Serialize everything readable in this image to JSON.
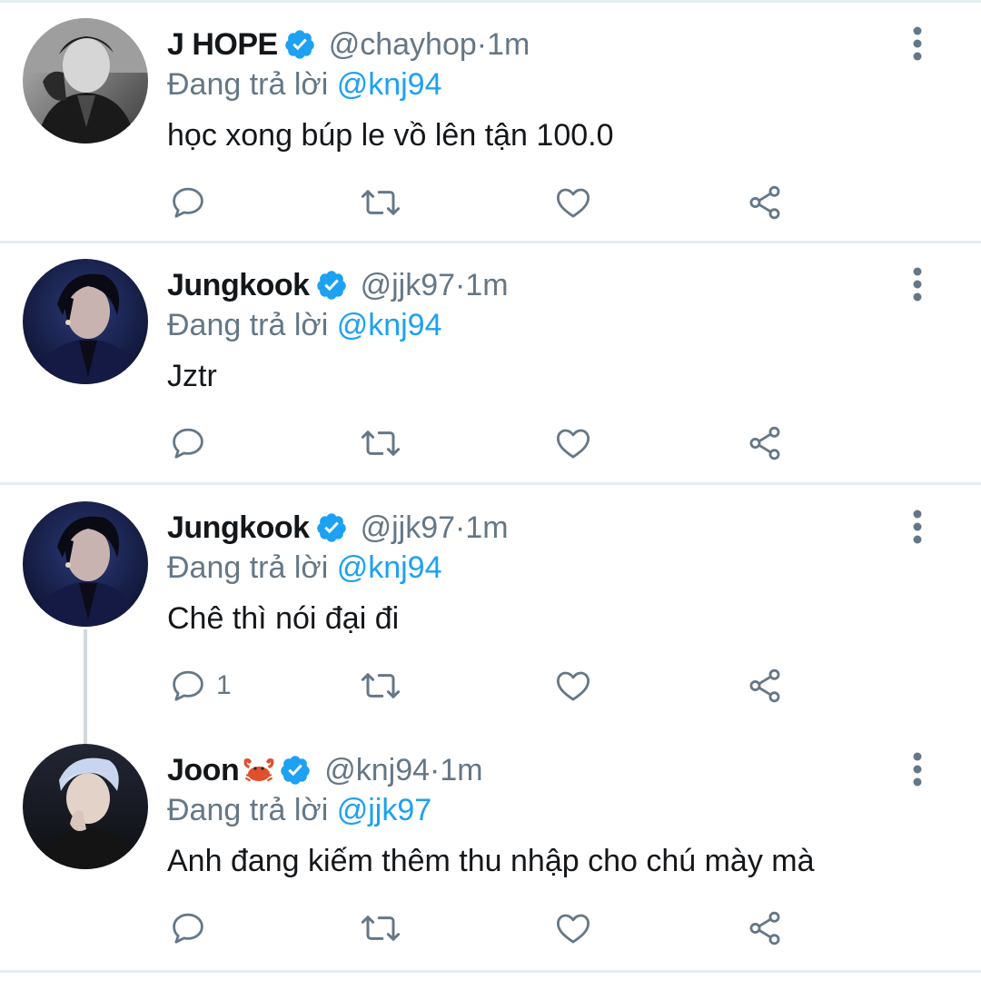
{
  "tweets": [
    {
      "name": "J HOPE",
      "handle": "@chayhop",
      "sep": " · ",
      "time": "1m",
      "reply_prefix": "Đang trả lời ",
      "reply_to": "@knj94",
      "text": "học xong búp le vồ lên tận 100.0",
      "reply_count": ""
    },
    {
      "name": "Jungkook",
      "handle": "@jjk97",
      "sep": " · ",
      "time": "1m",
      "reply_prefix": "Đang trả lời ",
      "reply_to": "@knj94",
      "text": "Jztr",
      "reply_count": ""
    },
    {
      "name": "Jungkook",
      "handle": "@jjk97",
      "sep": " · ",
      "time": "1m",
      "reply_prefix": "Đang trả lời ",
      "reply_to": "@knj94",
      "text": "Chê thì nói đại đi",
      "reply_count": "1"
    },
    {
      "name": "Joon",
      "name_emoji": "crab",
      "handle": "@knj94",
      "sep": " · ",
      "time": "1m",
      "reply_prefix": "Đang trả lời ",
      "reply_to": "@jjk97",
      "text": "Anh đang kiếm thêm thu nhập cho chú mày mà",
      "reply_count": ""
    }
  ],
  "colors": {
    "accent": "#1da1f2",
    "secondary_text": "#657786",
    "primary_text": "#14171a",
    "divider": "#e6ecf0",
    "thread_line": "#cfd9de"
  },
  "icons": {
    "verified": "verified-badge-icon",
    "more": "more-vertical-icon",
    "reply": "reply-bubble-icon",
    "retweet": "retweet-icon",
    "like": "heart-icon",
    "share": "share-icon"
  }
}
